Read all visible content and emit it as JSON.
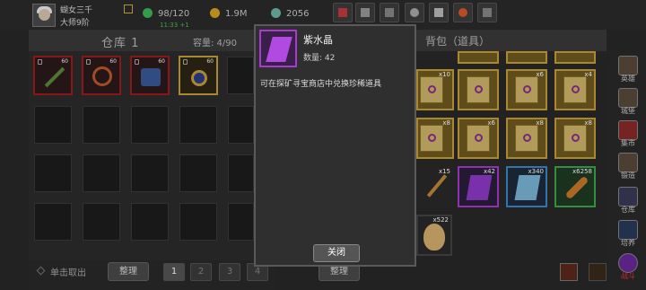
{
  "player": {
    "name": "蝴女三千",
    "rank": "大师9阶",
    "clock": "11:33 +1"
  },
  "stats": {
    "energy": "98/120",
    "gold": "1.9M",
    "gems": "2056"
  },
  "warehouse": {
    "title": "仓库 1",
    "capacity": "容量: 4/90",
    "items": [
      {
        "level": "60",
        "icon": "staff-icon"
      },
      {
        "level": "60",
        "icon": "amulet-icon"
      },
      {
        "level": "60",
        "icon": "armor-icon"
      },
      {
        "level": "60",
        "icon": "ring-icon"
      }
    ]
  },
  "bottom": {
    "hint": "单击取出",
    "sort_left": "整理",
    "pages": [
      "1",
      "2",
      "3",
      "4"
    ],
    "sort_right": "整理"
  },
  "bag": {
    "title": "背包（道具）",
    "counts": [
      "x10",
      "x6",
      "x4",
      "x8",
      "x6",
      "x8",
      "x8",
      "x15",
      "x42",
      "x340",
      "x6258",
      "x522"
    ]
  },
  "sidebar": {
    "items": [
      "英雄",
      "城堡",
      "集市",
      "锻造",
      "仓库",
      "培养",
      "战斗"
    ]
  },
  "popup": {
    "item_name": "紫水晶",
    "quantity": "数量: 42",
    "description": "可在探矿寻宝商店中兑换珍稀道具",
    "close": "关闭"
  },
  "colors": {
    "accent_red": "#9e1d1d",
    "accent_gold": "#c8a03a",
    "amethyst": "#a83ad0"
  }
}
